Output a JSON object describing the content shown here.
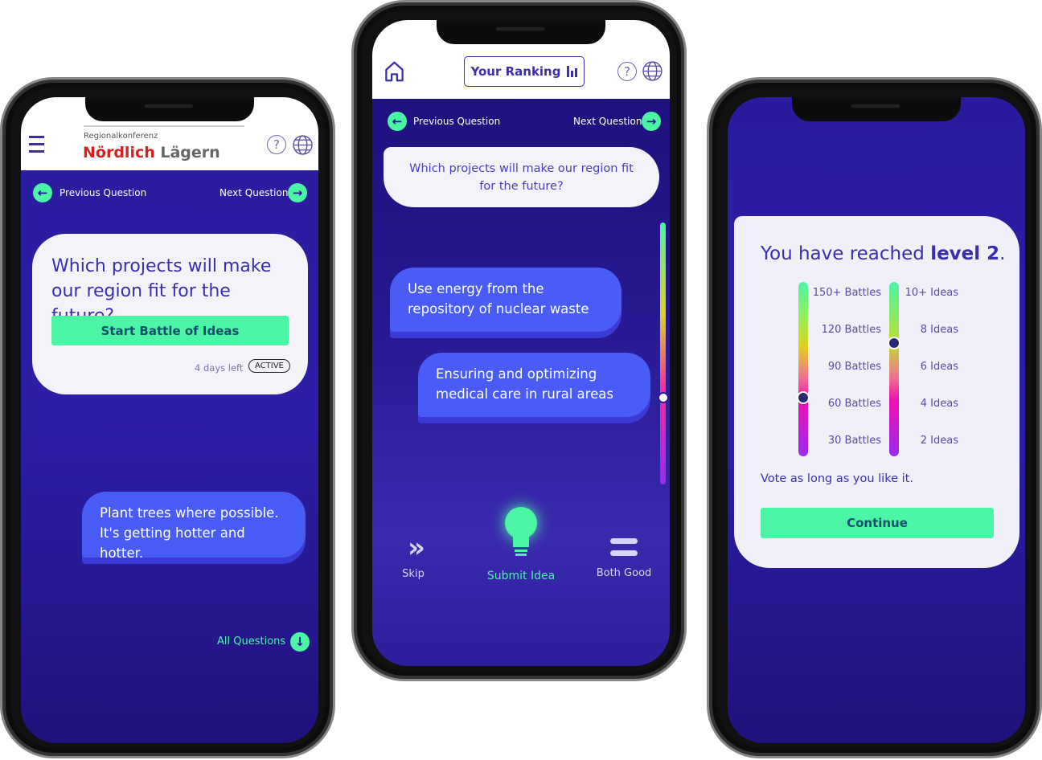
{
  "phone1": {
    "brand_small": "Regionalkonferenz",
    "brand_red": "Nördlich",
    "brand_gray": "Lägern",
    "help_icon": "?",
    "prev": "Previous Question",
    "next": "Next Question",
    "question": "Which projects will make our region fit for the future?",
    "start_button": "Start Battle of Ideas",
    "days_left": "4 days left",
    "status": "ACTIVE",
    "idea": "Plant trees where possible. It's getting hotter and hotter.",
    "all_questions": "All Questions"
  },
  "phone2": {
    "ranking": "Your Ranking",
    "help_icon": "?",
    "prev": "Previous Question",
    "next": "Next Question",
    "question": "Which projects will make our region fit for the future?",
    "idea1": "Use energy from the repository of nuclear waste",
    "idea2": "Ensuring and optimizing medical care in rural areas",
    "skip": "Skip",
    "submit": "Submit Idea",
    "both_good": "Both Good",
    "progress_percent": 33
  },
  "phone3": {
    "title_prefix": "You have reached",
    "title_level": "level 2",
    "title_suffix": ".",
    "battles_labels": [
      "150+ Battles",
      "120 Battles",
      "90 Battles",
      "60 Battles",
      "30 Battles"
    ],
    "ideas_labels": [
      "10+ Ideas",
      "8 Ideas",
      "6 Ideas",
      "4 Ideas",
      "2 Ideas"
    ],
    "battles_value": 62,
    "ideas_value": 7.1,
    "note": "Vote as long as you like it.",
    "continue": "Continue"
  },
  "colors": {
    "accent": "#4cf4a6",
    "primary": "#2a1b9e",
    "bubble": "#4a5cf6",
    "brand_red": "#d42020"
  }
}
